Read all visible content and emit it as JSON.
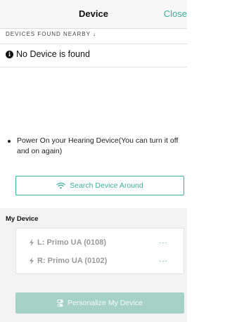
{
  "header": {
    "title": "Device",
    "close_label": "Close"
  },
  "nearby": {
    "section_label": "DEVICES FOUND NEARBY",
    "sort_arrow": "↓",
    "empty_message": "No Device is found",
    "tip": "Power On your Hearing Device(You can turn it off and on again)",
    "search_button_label": "Search Device Around"
  },
  "my_device": {
    "label": "My Device",
    "devices": [
      {
        "name": "L: Primo UA (0108)",
        "more": "···"
      },
      {
        "name": "R: Primo UA (0102)",
        "more": "···"
      }
    ],
    "personalize_label": "Personalize My Device"
  },
  "icons": {
    "info": "info-circle-icon",
    "wifi": "wifi-icon",
    "bolt": "bolt-icon",
    "toggle": "toggle-icon"
  },
  "colors": {
    "accent": "#3fae9a",
    "personalize_bg": "#a6d2c5",
    "device_text": "#9a9a9a"
  }
}
